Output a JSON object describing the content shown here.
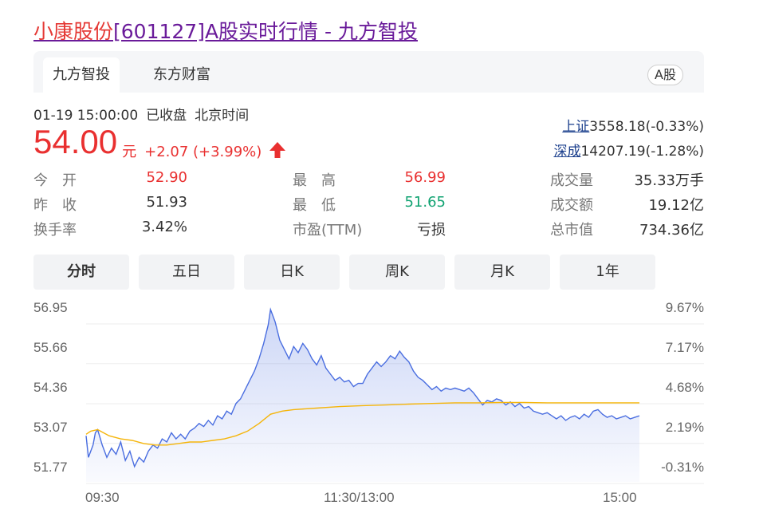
{
  "page_title": {
    "stock_name": "小康股份",
    "rest": "[601127]A股实时行情 - 九方智投"
  },
  "source_tabs": [
    {
      "label": "九方智投",
      "active": true
    },
    {
      "label": "东方财富",
      "active": false
    }
  ],
  "market_badge": "A股",
  "quote_meta": {
    "datetime": "01-19 15:00:00",
    "status": "已收盘",
    "timezone": "北京时间"
  },
  "quote": {
    "price": "54.00",
    "unit": "元",
    "change": "+2.07 (+3.99%)"
  },
  "indices": [
    {
      "name": "上证",
      "value": "3558.18(-0.33%)"
    },
    {
      "name": "深成",
      "value": "14207.19(-1.28%)"
    }
  ],
  "stats": {
    "open_label": "今　开",
    "open": "52.90",
    "prev_close_label": "昨　收",
    "prev_close": "51.93",
    "turnover_rate_label": "换手率",
    "turnover_rate": "3.42%",
    "high_label": "最　高",
    "high": "56.99",
    "low_label": "最　低",
    "low": "51.65",
    "pe_label": "市盈(TTM)",
    "pe": "亏损",
    "volume_label": "成交量",
    "volume": "35.33万手",
    "amount_label": "成交额",
    "amount": "19.12亿",
    "market_cap_label": "总市值",
    "market_cap": "734.36亿"
  },
  "period_tabs": [
    {
      "label": "分时",
      "active": true
    },
    {
      "label": "五日",
      "active": false
    },
    {
      "label": "日K",
      "active": false
    },
    {
      "label": "周K",
      "active": false
    },
    {
      "label": "月K",
      "active": false
    },
    {
      "label": "1年",
      "active": false
    }
  ],
  "colors": {
    "price_up": "#e93030",
    "price_down": "#11a372",
    "line": "#4a6ee0",
    "avg": "#f5b50a",
    "link": "#1a3e8c"
  },
  "chart_data": {
    "type": "line",
    "y_ticks": [
      "56.95",
      "55.66",
      "54.36",
      "53.07",
      "51.77"
    ],
    "y_tick_values": [
      56.95,
      55.66,
      54.36,
      53.07,
      51.77
    ],
    "pct_ticks": [
      "9.67%",
      "7.17%",
      "4.68%",
      "2.19%",
      "-0.31%"
    ],
    "x_ticks": [
      "09:30",
      "11:30/13:00",
      "15:00"
    ],
    "ylim": [
      51.77,
      56.95
    ],
    "grid": true,
    "minutes_total": 240,
    "series": [
      {
        "values": [
          [
            0,
            52.8
          ],
          [
            1,
            52.1
          ],
          [
            3,
            52.5
          ],
          [
            4,
            52.9
          ],
          [
            5,
            53.0
          ],
          [
            7,
            52.5
          ],
          [
            9,
            52.1
          ],
          [
            11,
            52.4
          ],
          [
            13,
            52.2
          ],
          [
            15,
            52.6
          ],
          [
            17,
            52.0
          ],
          [
            19,
            52.3
          ],
          [
            21,
            51.8
          ],
          [
            23,
            52.1
          ],
          [
            25,
            51.95
          ],
          [
            27,
            52.3
          ],
          [
            29,
            52.5
          ],
          [
            31,
            52.4
          ],
          [
            33,
            52.7
          ],
          [
            35,
            52.6
          ],
          [
            37,
            52.9
          ],
          [
            39,
            52.7
          ],
          [
            41,
            52.85
          ],
          [
            43,
            52.7
          ],
          [
            45,
            52.95
          ],
          [
            47,
            53.05
          ],
          [
            49,
            53.2
          ],
          [
            51,
            53.1
          ],
          [
            53,
            53.3
          ],
          [
            55,
            53.15
          ],
          [
            57,
            53.45
          ],
          [
            59,
            53.35
          ],
          [
            61,
            53.6
          ],
          [
            63,
            53.5
          ],
          [
            65,
            53.85
          ],
          [
            67,
            54.0
          ],
          [
            69,
            54.3
          ],
          [
            71,
            54.6
          ],
          [
            73,
            54.9
          ],
          [
            75,
            55.3
          ],
          [
            77,
            55.8
          ],
          [
            79,
            56.4
          ],
          [
            80,
            56.9
          ],
          [
            82,
            56.5
          ],
          [
            84,
            55.9
          ],
          [
            86,
            55.6
          ],
          [
            88,
            55.3
          ],
          [
            90,
            55.7
          ],
          [
            92,
            55.5
          ],
          [
            94,
            55.8
          ],
          [
            96,
            55.6
          ],
          [
            98,
            55.3
          ],
          [
            100,
            55.1
          ],
          [
            102,
            55.4
          ],
          [
            104,
            55.0
          ],
          [
            106,
            54.8
          ],
          [
            108,
            54.6
          ],
          [
            110,
            54.7
          ],
          [
            112,
            54.55
          ],
          [
            114,
            54.6
          ],
          [
            116,
            54.4
          ],
          [
            118,
            54.5
          ],
          [
            120,
            54.5
          ],
          [
            122,
            54.8
          ],
          [
            124,
            55.0
          ],
          [
            126,
            55.2
          ],
          [
            128,
            55.05
          ],
          [
            130,
            55.2
          ],
          [
            132,
            55.4
          ],
          [
            134,
            55.3
          ],
          [
            136,
            55.55
          ],
          [
            138,
            55.35
          ],
          [
            140,
            55.2
          ],
          [
            142,
            54.9
          ],
          [
            144,
            54.7
          ],
          [
            146,
            54.6
          ],
          [
            148,
            54.45
          ],
          [
            150,
            54.3
          ],
          [
            152,
            54.4
          ],
          [
            154,
            54.25
          ],
          [
            156,
            54.35
          ],
          [
            158,
            54.3
          ],
          [
            160,
            54.35
          ],
          [
            162,
            54.3
          ],
          [
            164,
            54.25
          ],
          [
            166,
            54.35
          ],
          [
            168,
            54.2
          ],
          [
            170,
            54.0
          ],
          [
            172,
            53.8
          ],
          [
            174,
            53.95
          ],
          [
            176,
            53.9
          ],
          [
            178,
            54.0
          ],
          [
            180,
            53.95
          ],
          [
            182,
            53.8
          ],
          [
            184,
            53.9
          ],
          [
            186,
            53.75
          ],
          [
            188,
            53.85
          ],
          [
            190,
            53.7
          ],
          [
            192,
            53.75
          ],
          [
            194,
            53.6
          ],
          [
            196,
            53.55
          ],
          [
            198,
            53.5
          ],
          [
            200,
            53.55
          ],
          [
            202,
            53.45
          ],
          [
            204,
            53.35
          ],
          [
            206,
            53.45
          ],
          [
            208,
            53.3
          ],
          [
            210,
            53.4
          ],
          [
            212,
            53.45
          ],
          [
            214,
            53.35
          ],
          [
            216,
            53.5
          ],
          [
            218,
            53.4
          ],
          [
            220,
            53.6
          ],
          [
            222,
            53.65
          ],
          [
            224,
            53.5
          ],
          [
            226,
            53.4
          ],
          [
            228,
            53.45
          ],
          [
            230,
            53.35
          ],
          [
            232,
            53.4
          ],
          [
            234,
            53.45
          ],
          [
            236,
            53.35
          ],
          [
            238,
            53.4
          ],
          [
            240,
            53.45
          ]
        ]
      },
      {
        "values": [
          [
            0,
            52.85
          ],
          [
            2,
            52.95
          ],
          [
            5,
            53.0
          ],
          [
            10,
            52.8
          ],
          [
            15,
            52.7
          ],
          [
            20,
            52.65
          ],
          [
            25,
            52.55
          ],
          [
            30,
            52.5
          ],
          [
            35,
            52.5
          ],
          [
            40,
            52.55
          ],
          [
            45,
            52.6
          ],
          [
            50,
            52.6
          ],
          [
            55,
            52.65
          ],
          [
            60,
            52.7
          ],
          [
            65,
            52.8
          ],
          [
            70,
            52.95
          ],
          [
            75,
            53.2
          ],
          [
            80,
            53.5
          ],
          [
            85,
            53.6
          ],
          [
            90,
            53.65
          ],
          [
            100,
            53.7
          ],
          [
            110,
            53.75
          ],
          [
            120,
            53.78
          ],
          [
            130,
            53.8
          ],
          [
            140,
            53.83
          ],
          [
            150,
            53.85
          ],
          [
            160,
            53.87
          ],
          [
            170,
            53.87
          ],
          [
            180,
            53.88
          ],
          [
            190,
            53.88
          ],
          [
            200,
            53.87
          ],
          [
            210,
            53.87
          ],
          [
            220,
            53.87
          ],
          [
            230,
            53.87
          ],
          [
            240,
            53.87
          ]
        ]
      }
    ]
  }
}
